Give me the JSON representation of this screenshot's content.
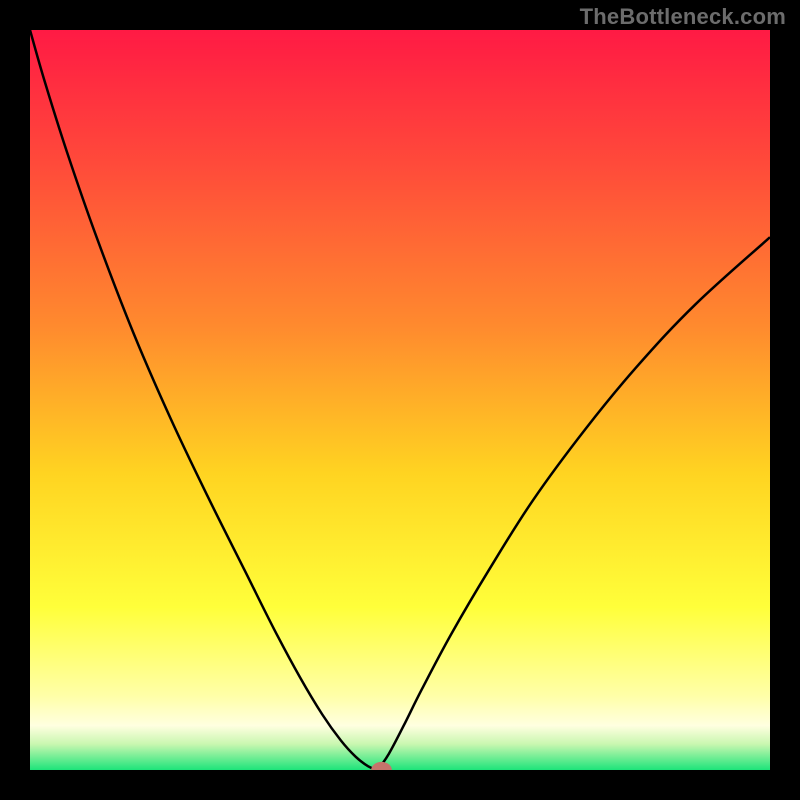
{
  "brand": "TheBottleneck.com",
  "colors": {
    "black": "#000000",
    "curve": "#000000",
    "marker": "#c5746b"
  },
  "chart_data": {
    "type": "line",
    "title": "",
    "xlabel": "",
    "ylabel": "",
    "xlim": [
      0,
      100
    ],
    "ylim": [
      0,
      100
    ],
    "gradient_stops": [
      {
        "offset": 0.0,
        "color": "#ff1a44"
      },
      {
        "offset": 0.18,
        "color": "#ff4a3a"
      },
      {
        "offset": 0.4,
        "color": "#ff8a2e"
      },
      {
        "offset": 0.6,
        "color": "#ffd421"
      },
      {
        "offset": 0.78,
        "color": "#ffff3a"
      },
      {
        "offset": 0.9,
        "color": "#ffffa8"
      },
      {
        "offset": 0.94,
        "color": "#ffffe0"
      },
      {
        "offset": 0.965,
        "color": "#c9f7b0"
      },
      {
        "offset": 1.0,
        "color": "#1de47a"
      }
    ],
    "series": [
      {
        "name": "left-branch",
        "x": [
          0,
          2,
          5,
          9,
          14,
          19,
          24,
          29,
          33,
          36.5,
          39.5,
          42,
          44,
          45.7,
          47
        ],
        "y": [
          100,
          93,
          83.5,
          72,
          59,
          47.5,
          37,
          27,
          19,
          12.5,
          7.5,
          4,
          1.8,
          0.5,
          0
        ]
      },
      {
        "name": "right-branch",
        "x": [
          47,
          48.5,
          50.5,
          53,
          57,
          62,
          68,
          75,
          82,
          90,
          100
        ],
        "y": [
          0,
          2.2,
          6,
          11,
          18.5,
          27,
          36.5,
          46,
          54.5,
          63,
          72
        ]
      }
    ],
    "marker": {
      "x": 47.5,
      "y": 0,
      "rx": 1.4,
      "ry": 1.1
    }
  }
}
